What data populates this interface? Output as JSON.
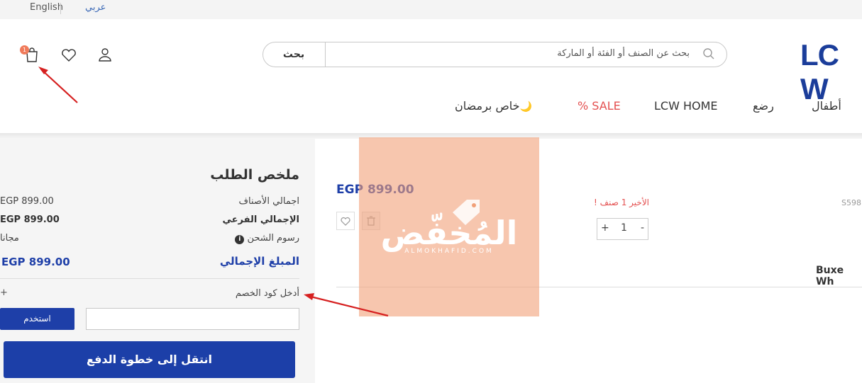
{
  "lang": {
    "english": "English",
    "arabic": "عربي"
  },
  "header": {
    "cart_count": "1",
    "search_button": "بحث",
    "search_placeholder": "بحث عن الصنف أو الفئة أو الماركة",
    "logo": "LC W"
  },
  "nav": {
    "items": [
      "أطفال",
      "رضع",
      "LCW HOME",
      "% SALE",
      "خاص برمضان"
    ],
    "moon_icon": "🌙"
  },
  "summary": {
    "title": "ملخص الطلب",
    "rows": [
      {
        "label": "اجمالي الأصناف",
        "value": "EGP 899.00"
      },
      {
        "label": "الإجمالي الفرعي",
        "value": "EGP 899.00"
      },
      {
        "label": "رسوم الشحن",
        "value": "مجانا"
      }
    ],
    "total_label": "المبلغ الإجمالي",
    "total_value": "EGP 899.00",
    "discount_label": "أدخل كود الخصم",
    "discount_toggle": "+",
    "use_button": "استخدم",
    "checkout_button": "انتقل إلى خطوة الدفع"
  },
  "product": {
    "price": "EGP 899.00",
    "last_item": "الأخير 1 صنف !",
    "sku": "S598",
    "quantity": "1",
    "qty_plus": "+",
    "qty_minus": "-",
    "name": "Buxe Wh"
  },
  "watermark": {
    "text": "المُخفّض",
    "sub": "ALMOKHAFID.COM"
  },
  "colors": {
    "brand": "#1e3fa8",
    "sale": "#e45050",
    "watermark": "#f1a078"
  }
}
